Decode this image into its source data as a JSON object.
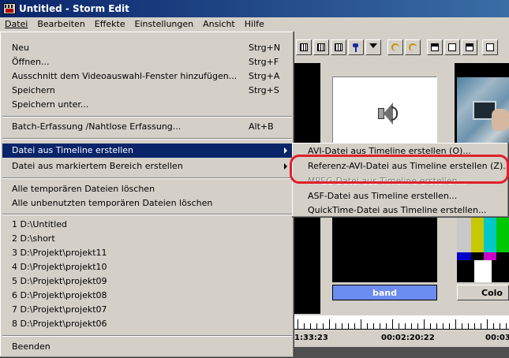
{
  "window": {
    "title": "Untitled - Storm Edit"
  },
  "menubar": {
    "items": [
      {
        "label": "Datei"
      },
      {
        "label": "Bearbeiten"
      },
      {
        "label": "Effekte"
      },
      {
        "label": "Einstellungen"
      },
      {
        "label": "Ansicht"
      },
      {
        "label": "Hilfe"
      }
    ]
  },
  "datei_menu": {
    "neu": {
      "label": "Neu",
      "shortcut": "Strg+N"
    },
    "oeffnen": {
      "label": "Öffnen...",
      "shortcut": "Strg+F"
    },
    "ausschnitt": {
      "label": "Ausschnitt dem Videoauswahl-Fenster hinzufügen...",
      "shortcut": "Strg+A"
    },
    "speichern": {
      "label": "Speichern",
      "shortcut": "Strg+S"
    },
    "speichern_unter": {
      "label": "Speichern unter..."
    },
    "batch": {
      "label": "Batch-Erfassung /Nahtlose Erfassung...",
      "shortcut": "Alt+B"
    },
    "datei_aus_timeline": {
      "label": "Datei aus Timeline erstellen"
    },
    "datei_aus_bereich": {
      "label": "Datei aus markiertem Bereich erstellen"
    },
    "temp_loeschen": {
      "label": "Alle temporären Dateien löschen"
    },
    "unbenutzt_loeschen": {
      "label": "Alle unbenutzten temporären Dateien löschen"
    },
    "recent": [
      "1 D:\\Untitled",
      "2 D:\\short",
      "3 D:\\Projekt\\projekt11",
      "4 D:\\Projekt\\projekt10",
      "5 D:\\Projekt\\projekt09",
      "6 D:\\Projekt\\projekt08",
      "7 D:\\Projekt\\projekt07",
      "8 D:\\Projekt\\projekt06"
    ],
    "beenden": {
      "label": "Beenden"
    }
  },
  "submenu": {
    "avi": "AVI-Datei aus Timeline erstellen (O)...",
    "referenz_avi": "Referenz-AVI-Datei aus Timeline erstellen (Z)...",
    "mpeg": "MPEG-Datei aus Timeline erstellen...",
    "asf": "ASF-Datei aus Timeline erstellen...",
    "quicktime": "QuickTime-Datei aus Timeline erstellen..."
  },
  "background": {
    "clip_label_1": "band",
    "clip_label_2": "Colo",
    "timecodes": [
      "1:33:23",
      "00:02:20:22",
      "00:03"
    ]
  },
  "colors": {
    "highlight": "#0a246a",
    "annotation_ring": "#e0202a",
    "band_label": "#6b8cf0"
  }
}
